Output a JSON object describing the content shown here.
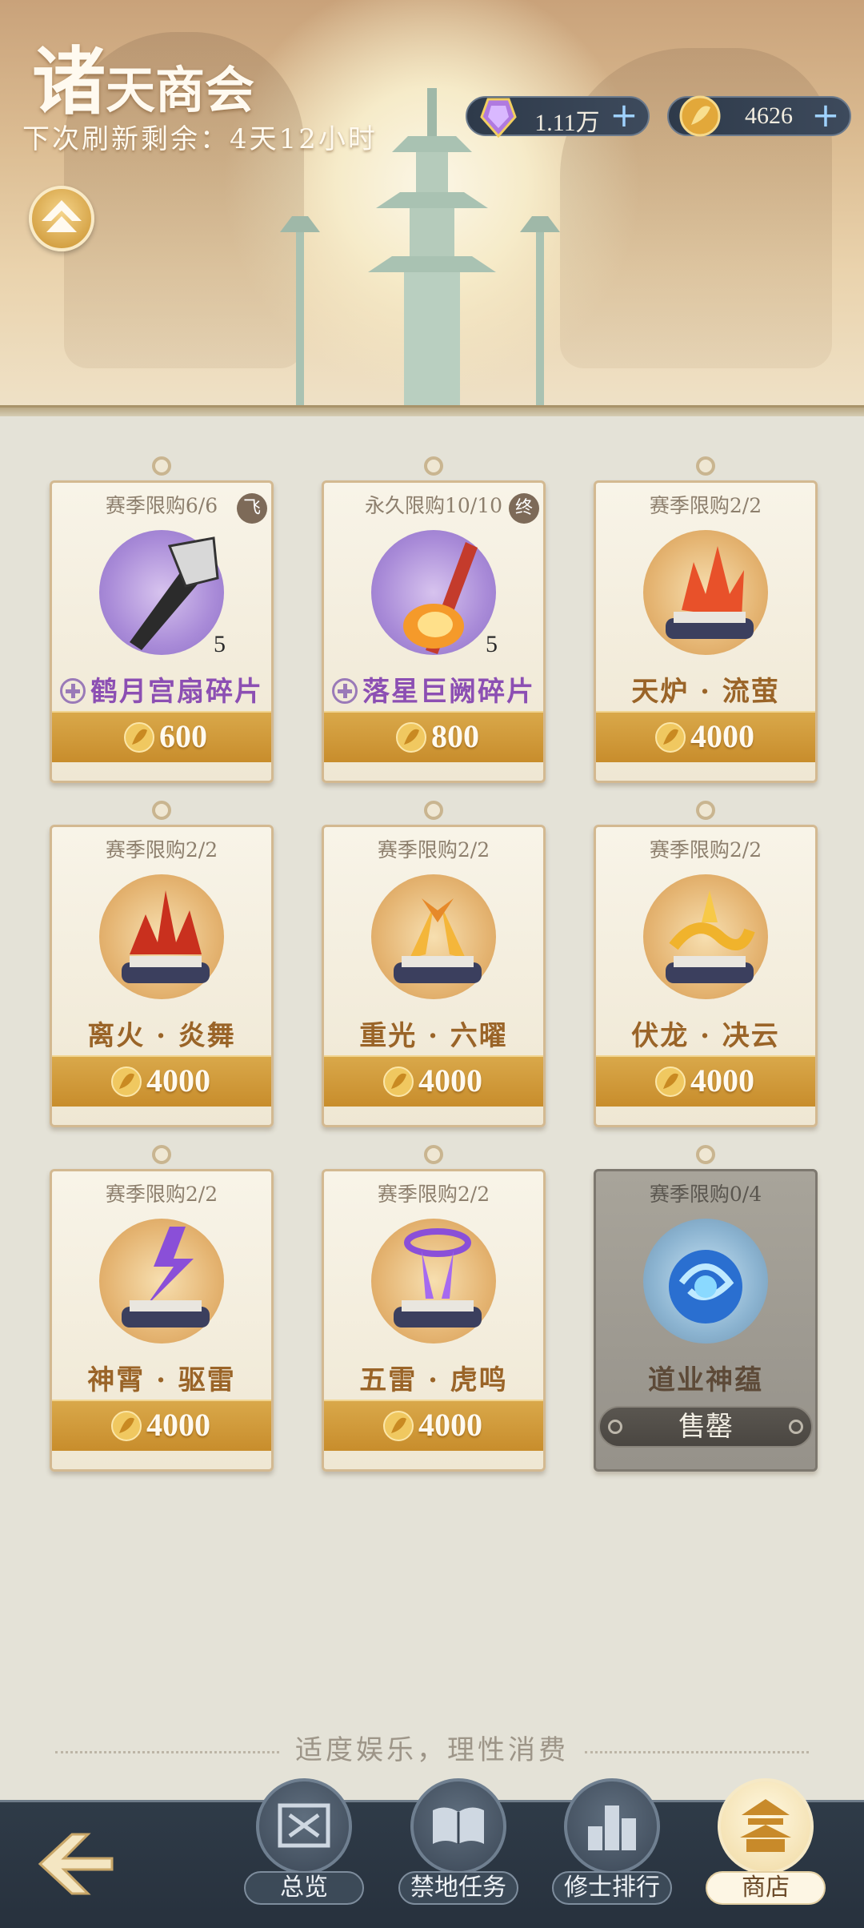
{
  "header": {
    "title_first_char": "诸",
    "title_rest": "天商会",
    "refresh_text": "下次刷新剩余：4天12小时"
  },
  "currencies": [
    {
      "icon": "purple-crystal-icon",
      "value": "1.11万",
      "plus": "+"
    },
    {
      "icon": "gold-leaf-coin-icon",
      "value": "4626",
      "plus": "+"
    }
  ],
  "shop_items": [
    {
      "limit": "赛季限购6/6",
      "tag": "飞",
      "name": "鹤月宫扇碎片",
      "qty": "5",
      "price": "600",
      "fragment": true
    },
    {
      "limit": "永久限购10/10",
      "tag": "终",
      "name": "落星巨阙碎片",
      "qty": "5",
      "price": "800",
      "fragment": true
    },
    {
      "limit": "赛季限购2/2",
      "name": "天炉 · 流萤",
      "price": "4000"
    },
    {
      "limit": "赛季限购2/2",
      "name": "离火 · 炎舞",
      "price": "4000"
    },
    {
      "limit": "赛季限购2/2",
      "name": "重光 · 六曜",
      "price": "4000"
    },
    {
      "limit": "赛季限购2/2",
      "name": "伏龙 · 决云",
      "price": "4000"
    },
    {
      "limit": "赛季限购2/2",
      "name": "神霄 · 驱雷",
      "price": "4000"
    },
    {
      "limit": "赛季限购2/2",
      "name": "五雷 · 虎鸣",
      "price": "4000"
    },
    {
      "limit": "赛季限购0/4",
      "name": "道业神蕴",
      "sold_label": "售罄"
    }
  ],
  "notice": "适度娱乐，理性消费",
  "nav": [
    {
      "label": "总览",
      "active": false
    },
    {
      "label": "禁地任务",
      "active": false
    },
    {
      "label": "修士排行",
      "active": false
    },
    {
      "label": "商店",
      "active": true
    }
  ],
  "colors": {
    "price_bar": "#d9a84a",
    "name_gold": "#9a6428",
    "name_purple": "#8c4fb3",
    "nav_bg": "#2f3b48"
  }
}
